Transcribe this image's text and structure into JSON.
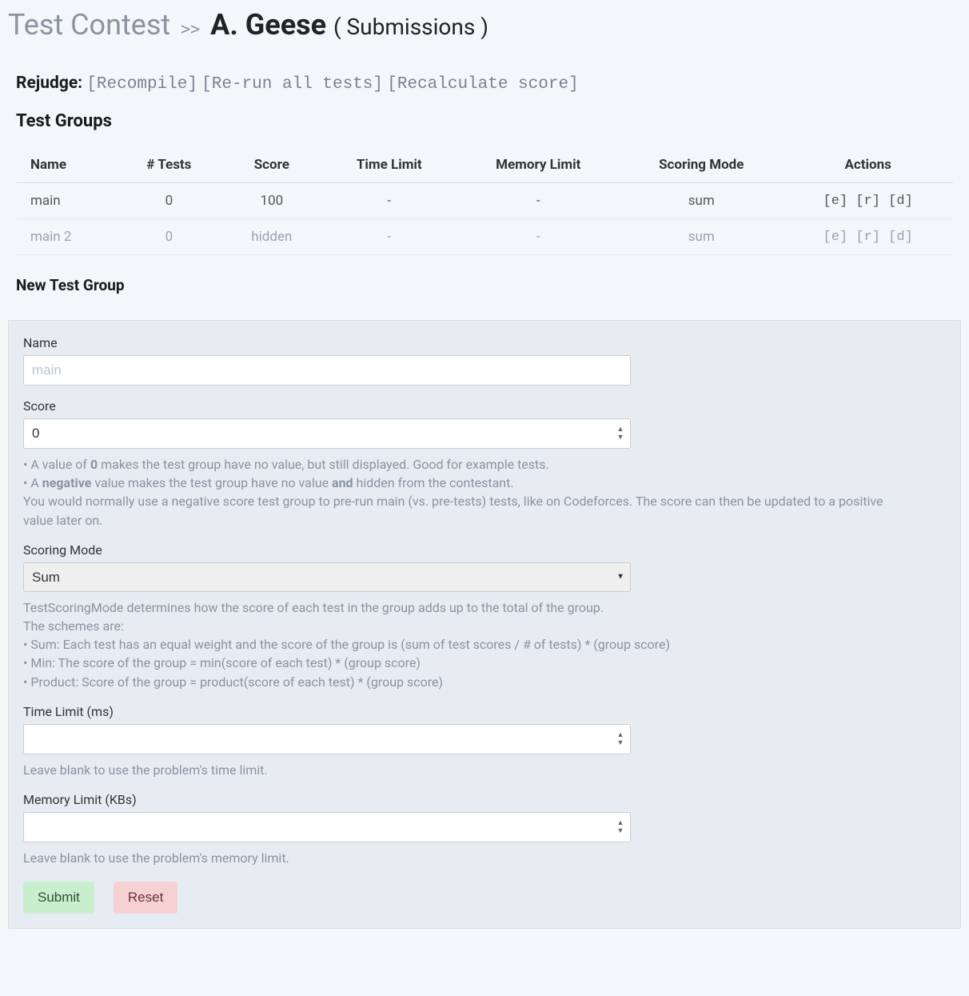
{
  "breadcrumb": {
    "contest": "Test Contest",
    "separator": ">>",
    "current": "A. Geese",
    "suffix": "( Submissions )"
  },
  "rejudge": {
    "label": "Rejudge:",
    "recompile": "[Recompile]",
    "rerun": "[Re-run all tests]",
    "recalc": "[Recalculate score]"
  },
  "test_groups": {
    "heading": "Test Groups",
    "columns": {
      "name": "Name",
      "tests": "# Tests",
      "score": "Score",
      "time": "Time Limit",
      "memory": "Memory Limit",
      "scoring": "Scoring Mode",
      "actions": "Actions"
    },
    "rows": [
      {
        "name": "main",
        "tests": "0",
        "score": "100",
        "time": "-",
        "memory": "-",
        "scoring": "sum"
      },
      {
        "name": "main 2",
        "tests": "0",
        "score": "hidden",
        "time": "-",
        "memory": "-",
        "scoring": "sum"
      }
    ],
    "actions": {
      "edit": "[e]",
      "reorder": "[r]",
      "delete": "[d]"
    }
  },
  "form": {
    "heading": "New Test Group",
    "name": {
      "label": "Name",
      "placeholder": "main",
      "value": ""
    },
    "score": {
      "label": "Score",
      "value": "0",
      "help_bullet1_pre": "A value of ",
      "help_bullet1_b": "0",
      "help_bullet1_post": " makes the test group have no value, but still displayed. Good for example tests.",
      "help_bullet2_pre": "A ",
      "help_bullet2_b1": "negative",
      "help_bullet2_mid": " value makes the test group have no value ",
      "help_bullet2_b2": "and",
      "help_bullet2_post": " hidden from the contestant.",
      "help_after": "You would normally use a negative score test group to pre-run main (vs. pre-tests) tests, like on Codeforces. The score can then be updated to a positive value later on."
    },
    "scoring": {
      "label": "Scoring Mode",
      "value": "Sum",
      "help_l1": "TestScoringMode determines how the score of each test in the group adds up to the total of the group.",
      "help_l2": "The schemes are:",
      "help_b1": "Sum: Each test has an equal weight and the score of the group is (sum of test scores / # of tests) * (group score)",
      "help_b2": "Min: The score of the group = min(score of each test) * (group score)",
      "help_b3": "Product: Score of the group = product(score of each test) * (group score)"
    },
    "time": {
      "label": "Time Limit (ms)",
      "value": "",
      "help": "Leave blank to use the problem's time limit."
    },
    "memory": {
      "label": "Memory Limit (KBs)",
      "value": "",
      "help": "Leave blank to use the problem's memory limit."
    },
    "buttons": {
      "submit": "Submit",
      "reset": "Reset"
    }
  }
}
